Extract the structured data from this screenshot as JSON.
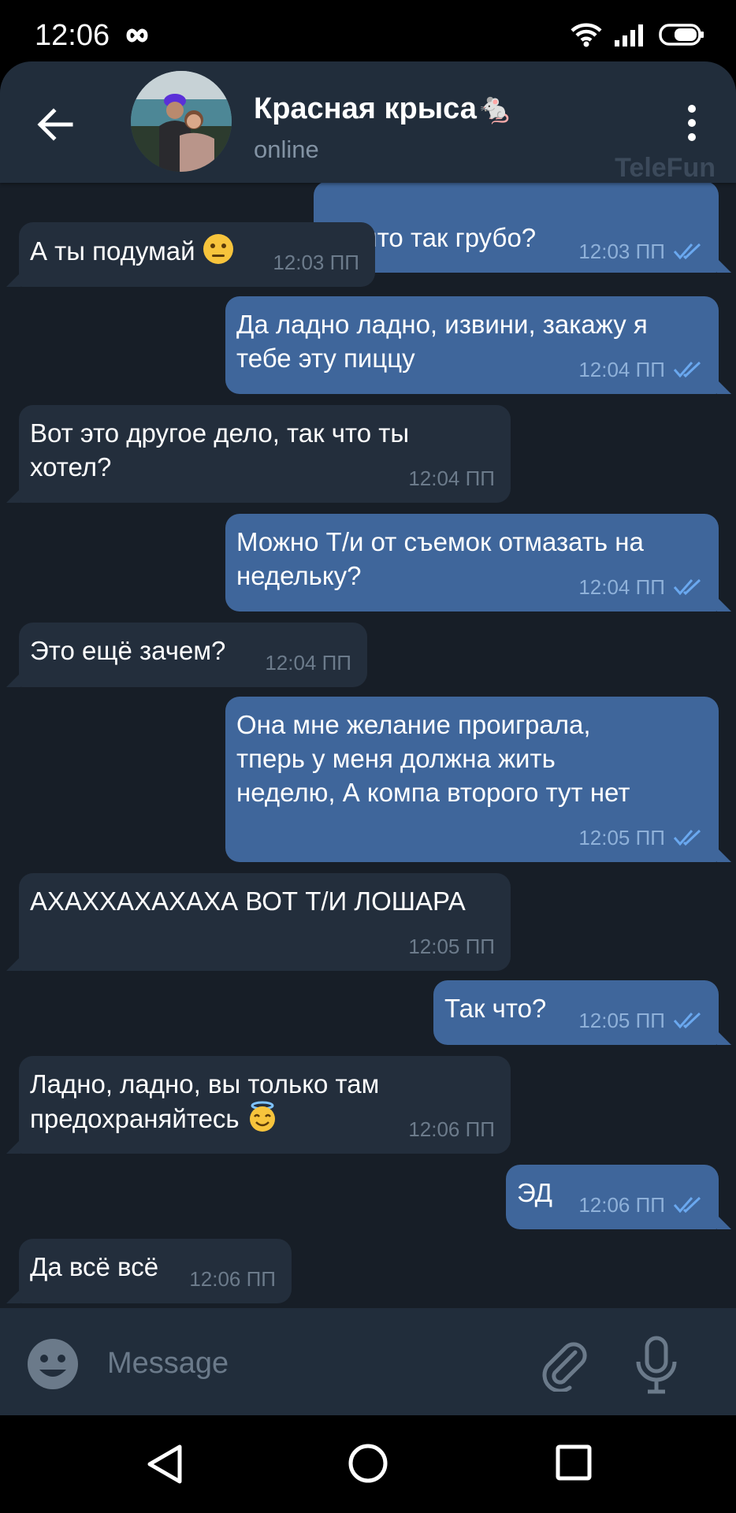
{
  "status_bar": {
    "time": "12:06",
    "infinity": "∞"
  },
  "header": {
    "name": "Красная крыса",
    "name_emoji": "🐁",
    "status": "online",
    "watermark": "TeleFun"
  },
  "messages": [
    {
      "dir": "out",
      "text": "Ну что так грубо?",
      "time": "12:03 ПП"
    },
    {
      "dir": "in",
      "text": "А ты подумай",
      "emoji": "neutral-face",
      "time": "12:03 ПП"
    },
    {
      "dir": "out",
      "line1": "Да ладно ладно, извини, закажу я",
      "line2": "тебе эту пиццу",
      "time": "12:04 ПП"
    },
    {
      "dir": "in",
      "line1": "Вот это другое дело, так что ты",
      "line2": "хотел?",
      "time": "12:04 ПП"
    },
    {
      "dir": "out",
      "line1": "Можно Т/и от съемок отмазать на",
      "line2": "недельку?",
      "time": "12:04 ПП"
    },
    {
      "dir": "in",
      "text": "Это ещё зачем?",
      "time": "12:04 ПП"
    },
    {
      "dir": "out",
      "line1": "Она мне желание проиграла,",
      "line2": "тперь у меня должна жить",
      "line3": "неделю, А компа второго тут нет",
      "time": "12:05 ПП"
    },
    {
      "dir": "in",
      "text": "АХАХХАХАХАХА ВОТ Т/И ЛОШАРА",
      "time": "12:05 ПП"
    },
    {
      "dir": "out",
      "text": "Так что?",
      "time": "12:05 ПП"
    },
    {
      "dir": "in",
      "line1": "Ладно, ладно, вы только там",
      "line2": "предохраняйтесь",
      "emoji": "smiling-face-with-halo",
      "time": "12:06 ПП"
    },
    {
      "dir": "out",
      "text": "ЭД",
      "time": "12:06 ПП"
    },
    {
      "dir": "in",
      "text": "Да всё всё",
      "time": "12:06 ПП"
    }
  ],
  "composer": {
    "placeholder": "Message"
  },
  "colors": {
    "background": "#171e27",
    "header": "#212d3b",
    "bubble_in": "#232e3c",
    "bubble_out": "#3f669b",
    "read_check": "#6aa8ef"
  }
}
